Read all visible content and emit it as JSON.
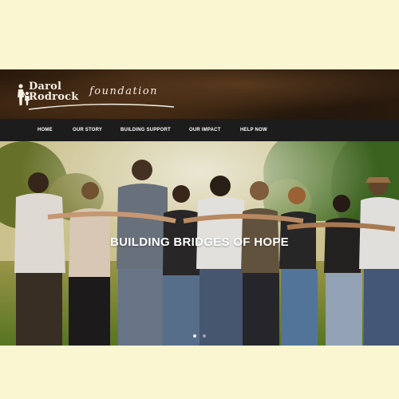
{
  "logo": {
    "name_line1": "Darol",
    "name_line2": "Rodrock",
    "tagline": "foundation",
    "icon": "parent-child-icon"
  },
  "nav": {
    "items": [
      {
        "label": "HOME"
      },
      {
        "label": "OUR STORY"
      },
      {
        "label": "BUILDING SUPPORT"
      },
      {
        "label": "OUR IMPACT"
      },
      {
        "label": "HELP NOW"
      }
    ]
  },
  "hero": {
    "title": "BUILDING BRIDGES OF HOPE",
    "slide_count": 2,
    "active_slide": 1
  },
  "colors": {
    "page_background": "#fbf6d2",
    "header_brown": "#3d2612",
    "nav_background": "#1c1c1c",
    "text_white": "#ffffff"
  }
}
